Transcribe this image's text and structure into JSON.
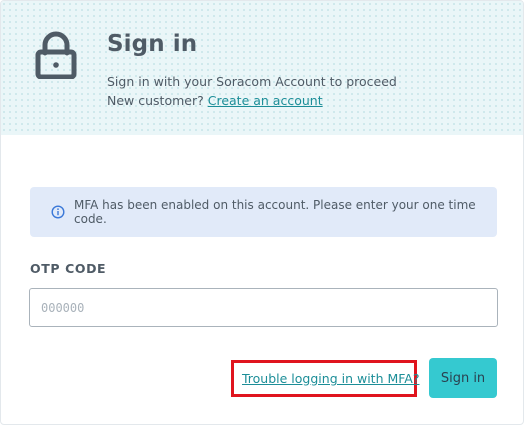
{
  "header": {
    "title": "Sign in",
    "subtitle_line1": "Sign in with your Soracom Account to proceed",
    "subtitle_line2_prefix": "New customer?",
    "create_account_link": "Create an account",
    "icon": "lock-icon"
  },
  "alert": {
    "icon": "info-icon",
    "message": "MFA has been enabled on this account. Please enter your one time code."
  },
  "form": {
    "otp_label": "OTP CODE",
    "otp_placeholder": "000000",
    "otp_value": ""
  },
  "actions": {
    "trouble_link": "Trouble logging in with MFA?",
    "signin_button": "Sign in"
  },
  "colors": {
    "accent": "#35c9d0",
    "link": "#1c8e98",
    "highlight": "#e0141e",
    "alert_bg": "#e1eaf9",
    "header_bg": "#eaf6f8"
  }
}
